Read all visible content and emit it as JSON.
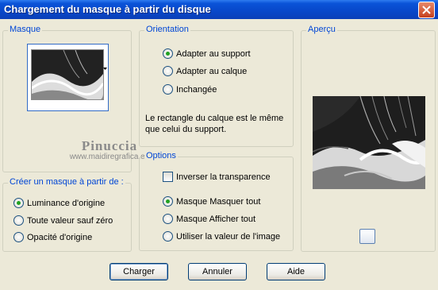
{
  "window": {
    "title": "Chargement du masque à partir du disque"
  },
  "masque": {
    "label": "Masque"
  },
  "watermark": {
    "line1": "Pinuccia",
    "line2": "www.maidiregrafica.eu"
  },
  "creer": {
    "label": "Créer un masque à partir de :",
    "options": [
      "Luminance d'origine",
      "Toute valeur sauf zéro",
      "Opacité d'origine"
    ],
    "selected": 0
  },
  "orientation": {
    "label": "Orientation",
    "options": [
      "Adapter au support",
      "Adapter au calque",
      "Inchangée"
    ],
    "selected": 0,
    "description": "Le rectangle du calque est le même que celui du support."
  },
  "options": {
    "label": "Options",
    "invert_label": "Inverser la transparence",
    "invert_checked": false,
    "choices": [
      "Masque Masquer tout",
      "Masque Afficher tout",
      "Utiliser la valeur de l'image"
    ],
    "selected": 0
  },
  "apercu": {
    "label": "Aperçu"
  },
  "buttons": {
    "charger": "Charger",
    "annuler": "Annuler",
    "aide": "Aide"
  }
}
